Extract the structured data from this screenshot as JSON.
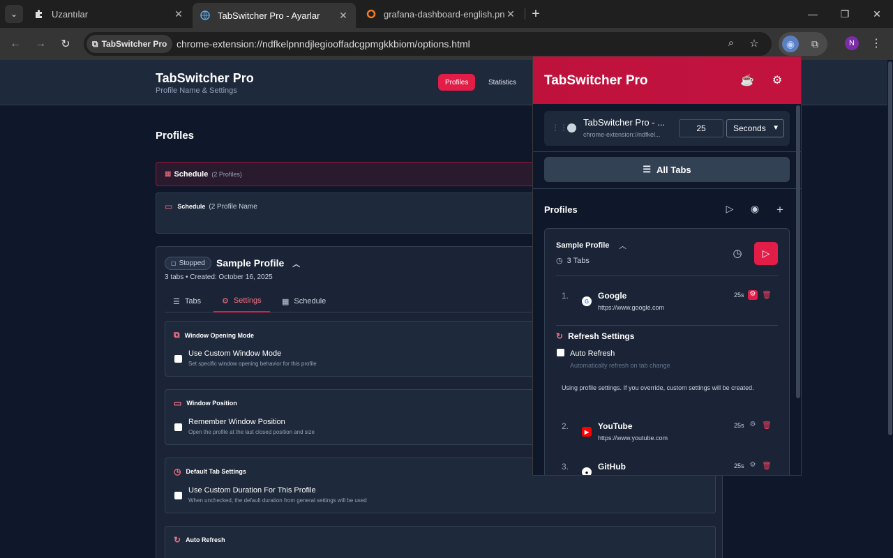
{
  "browser": {
    "tabs": [
      {
        "title": "Uzantılar",
        "icon": "puzzle-icon"
      },
      {
        "title": "TabSwitcher Pro - Ayarlar",
        "icon": "globe-icon"
      },
      {
        "title": "grafana-dashboard-english.png",
        "icon": "grafana-icon"
      }
    ],
    "site_chip": "TabSwitcher Pro",
    "url": "chrome-extension://ndfkelpnndjlegiooffadcgpmgkkbiom/options.html",
    "avatar": "N"
  },
  "page": {
    "app_title": "TabSwitcher Pro",
    "app_subtitle": "Profile Name & Settings",
    "nav": {
      "profiles": "Profiles",
      "statistics": "Statistics"
    },
    "section_title": "Profiles",
    "schedule_banner": {
      "label": "Schedule",
      "count": "(2 Profiles)"
    },
    "schedule_card": {
      "label": "Schedule",
      "rest": "(2 Profile Name"
    },
    "profile": {
      "status": "Stopped",
      "name": "Sample Profile",
      "meta": "3 tabs • Created: October 16, 2025",
      "tabs": {
        "tabs": "Tabs",
        "settings": "Settings",
        "schedule": "Schedule"
      },
      "settings": [
        {
          "head": "Window Opening Mode",
          "option": "Use Custom Window Mode",
          "desc": "Set specific window opening behavior for this profile"
        },
        {
          "head": "Window Position",
          "option": "Remember Window Position",
          "desc": "Open the profile at the last closed position and size"
        },
        {
          "head": "Default Tab Settings",
          "option": "Use Custom Duration For This Profile",
          "desc": "When unchecked, the default duration from general settings will be used"
        },
        {
          "head": "Auto Refresh"
        }
      ]
    }
  },
  "popup": {
    "title": "TabSwitcher Pro",
    "current_tab": {
      "title": "TabSwitcher Pro - ...",
      "url": "chrome-extension://ndfkel...",
      "duration": "25",
      "unit": "Seconds"
    },
    "all_tabs": "All Tabs",
    "profiles_label": "Profiles",
    "profile": {
      "name": "Sample Profile",
      "tab_count": "3 Tabs",
      "tabs": [
        {
          "num": "1.",
          "name": "Google",
          "url": "https://www.google.com",
          "duration": "25s"
        },
        {
          "num": "2.",
          "name": "YouTube",
          "url": "https://www.youtube.com",
          "duration": "25s"
        },
        {
          "num": "3.",
          "name": "GitHub",
          "url": "",
          "duration": "25s"
        }
      ],
      "refresh": {
        "head": "Refresh Settings",
        "label": "Auto Refresh",
        "desc": "Automatically refresh on tab change",
        "note": "Using profile settings. If you override, custom settings will be created."
      }
    }
  },
  "colors": {
    "accent": "#e11d48",
    "header": "#be123c",
    "bg": "#0f172a",
    "card": "#1e293b"
  }
}
